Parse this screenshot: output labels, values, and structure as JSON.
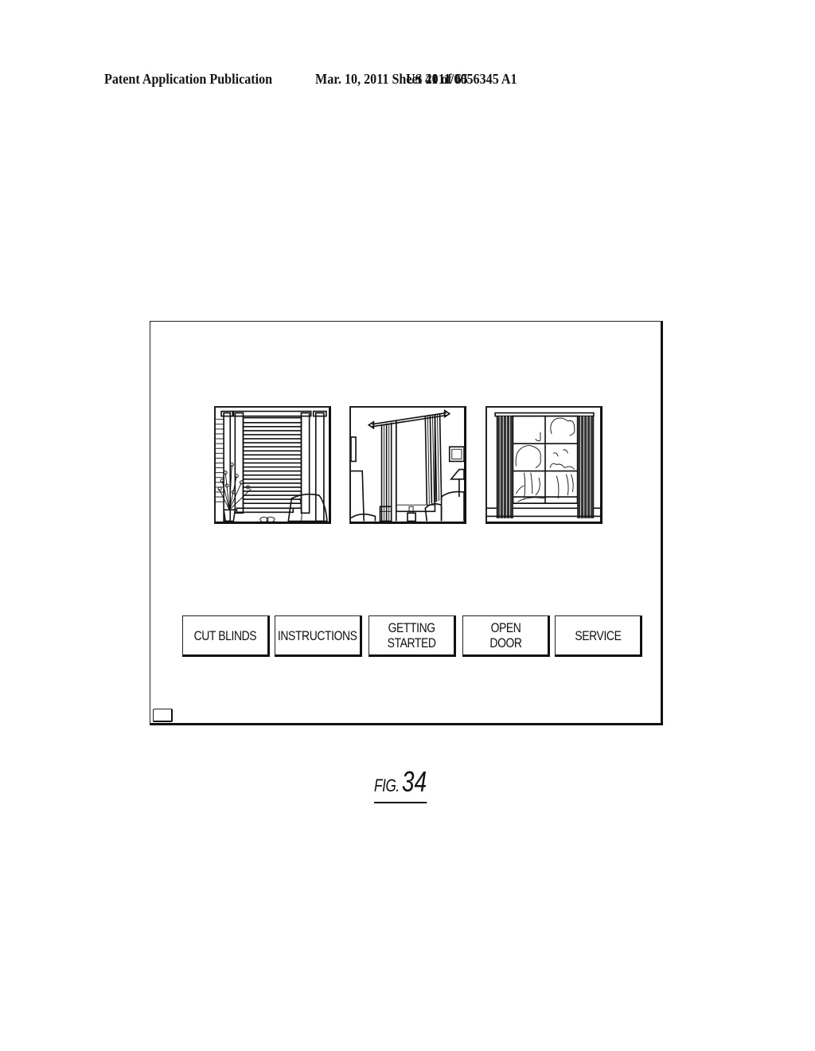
{
  "header": {
    "publication_type": "Patent Application Publication",
    "date_sheet": "Mar. 10, 2011  Sheet 41 of 65",
    "publication_number": "US 2011/0056345 A1"
  },
  "screen": {
    "thumbnails": [
      {
        "name": "blinds-scene",
        "icon": "window-blinds-icon"
      },
      {
        "name": "drapes-scene",
        "icon": "window-drapes-icon"
      },
      {
        "name": "curtains-scene",
        "icon": "window-curtains-icon"
      }
    ],
    "buttons": [
      {
        "label": "CUT BLINDS"
      },
      {
        "label": "INSTRUCTIONS"
      },
      {
        "label": "GETTING\nSTARTED"
      },
      {
        "label": "OPEN\nDOOR"
      },
      {
        "label": "SERVICE"
      }
    ],
    "corner_button": {
      "icon": "small-square-button"
    }
  },
  "figure": {
    "prefix": "FIG.",
    "number": "34"
  }
}
